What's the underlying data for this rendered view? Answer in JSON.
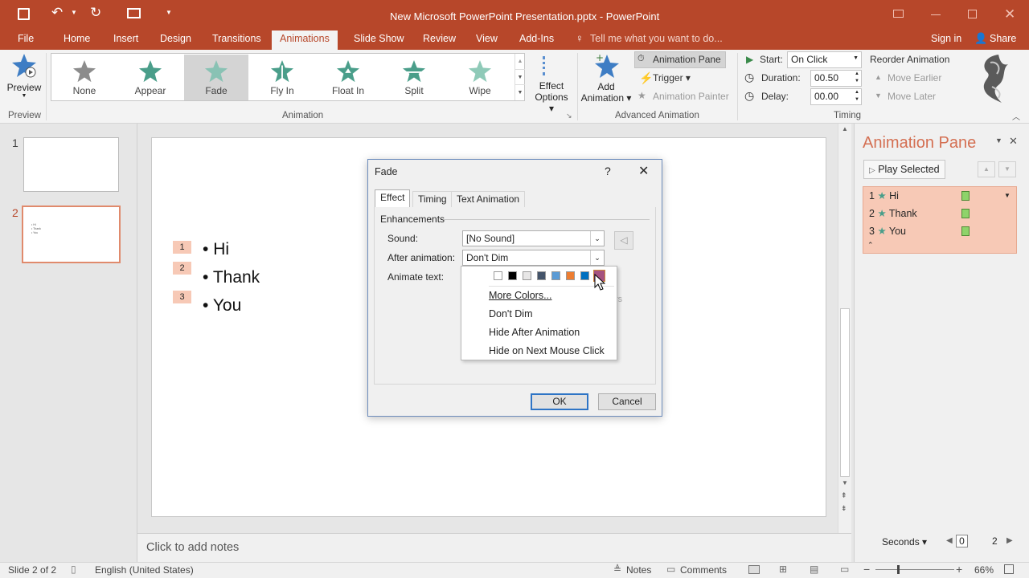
{
  "window": {
    "title": "New Microsoft PowerPoint Presentation.pptx - PowerPoint"
  },
  "tabs": [
    "File",
    "Home",
    "Insert",
    "Design",
    "Transitions",
    "Animations",
    "Slide Show",
    "Review",
    "View",
    "Add-Ins"
  ],
  "tell_me": "Tell me what you want to do...",
  "sign_in": "Sign in",
  "share": "Share",
  "preview": {
    "label": "Preview",
    "group": "Preview"
  },
  "gallery": [
    "None",
    "Appear",
    "Fade",
    "Fly In",
    "Float In",
    "Split",
    "Wipe"
  ],
  "effect_options": [
    "Effect",
    "Options"
  ],
  "animation_group": "Animation",
  "advanced": {
    "add_animation": [
      "Add",
      "Animation"
    ],
    "animation_pane": "Animation Pane",
    "trigger": "Trigger",
    "animation_painter": "Animation Painter",
    "group": "Advanced Animation"
  },
  "timing": {
    "start_label": "Start:",
    "start_value": "On Click",
    "duration_label": "Duration:",
    "duration_value": "00.50",
    "delay_label": "Delay:",
    "delay_value": "00.00",
    "reorder": "Reorder Animation",
    "move_earlier": "Move Earlier",
    "move_later": "Move Later",
    "group": "Timing"
  },
  "thumbnails": [
    {
      "num": "1"
    },
    {
      "num": "2",
      "lines": [
        "• Hi",
        "• Thank",
        "• You"
      ]
    }
  ],
  "slide": {
    "bullets": [
      {
        "tag": "1",
        "text": "Hi"
      },
      {
        "tag": "2",
        "text": "Thank"
      },
      {
        "tag": "3",
        "text": "You"
      }
    ]
  },
  "notes_placeholder": "Click to add notes",
  "dialog": {
    "title": "Fade",
    "help": "?",
    "tabs": [
      "Effect",
      "Timing",
      "Text Animation"
    ],
    "section": "Enhancements",
    "sound_label": "Sound:",
    "sound_value": "[No Sound]",
    "after_label": "After animation:",
    "after_value": "Don't Dim",
    "animate_label": "Animate text:",
    "hidden_fragment": "rs",
    "ok": "OK",
    "cancel": "Cancel"
  },
  "dropdown": {
    "colors": [
      "#ffffff",
      "#000000",
      "#e7e6e6",
      "#44546a",
      "#5b9bd5",
      "#ed7d31",
      "#0070c0",
      "#a5527f"
    ],
    "items": [
      "More Colors...",
      "Don't Dim",
      "Hide After Animation",
      "Hide on Next Mouse Click"
    ]
  },
  "pane": {
    "title": "Animation Pane",
    "play_selected": "Play Selected",
    "items": [
      {
        "num": "1",
        "label": "Hi"
      },
      {
        "num": "2",
        "label": "Thank"
      },
      {
        "num": "3",
        "label": "You"
      }
    ],
    "seconds": "Seconds",
    "timeline_start": "0",
    "timeline_end": "2"
  },
  "status": {
    "slide": "Slide 2 of 2",
    "language": "English (United States)",
    "notes": "Notes",
    "comments": "Comments",
    "zoom": "66%"
  },
  "colors": {
    "accent": "#b7472a",
    "selection": "#f7c9b6",
    "star_green": "#4a9e8a",
    "star_blue": "#3e7dc4"
  }
}
